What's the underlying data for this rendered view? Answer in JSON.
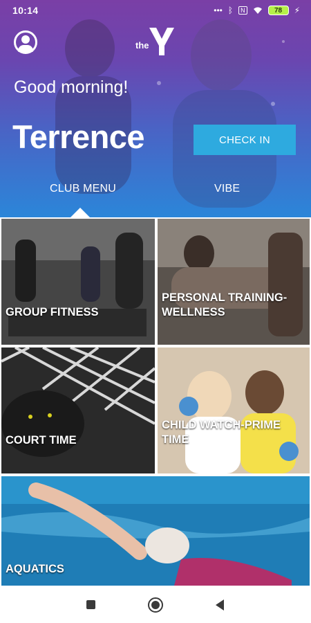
{
  "status_bar": {
    "time": "10:14",
    "icons": [
      "dots-icon",
      "bluetooth-icon",
      "nfc-icon",
      "wifi-icon",
      "battery-icon",
      "charging-icon"
    ],
    "battery_level": "78"
  },
  "header": {
    "logo_text": "the",
    "greeting": "Good morning!",
    "username": "Terrence",
    "check_in_label": "CHECK IN"
  },
  "tabs": [
    {
      "label": "CLUB MENU",
      "selected": true
    },
    {
      "label": "VIBE",
      "selected": false
    }
  ],
  "menu_tiles": [
    {
      "label": "GROUP FITNESS"
    },
    {
      "label": "PERSONAL TRAINING-WELLNESS"
    },
    {
      "label": "COURT TIME"
    },
    {
      "label": "CHILD WATCH-PRIME TIME"
    },
    {
      "label": "AQUATICS"
    }
  ],
  "colors": {
    "gradient_top": "#7a3fa6",
    "gradient_bottom": "#2b86d9",
    "accent": "#2eaadf"
  },
  "nav_bar": {
    "icons": [
      "recents-square-icon",
      "home-circle-icon",
      "back-triangle-icon"
    ]
  }
}
